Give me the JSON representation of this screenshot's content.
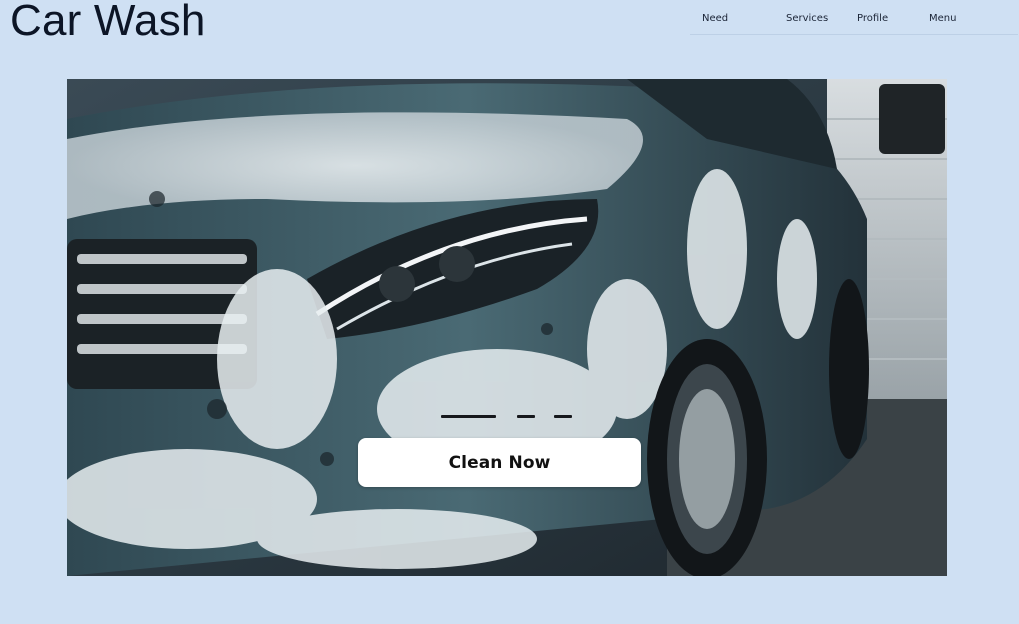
{
  "header": {
    "brand": "Car Wash",
    "nav": [
      {
        "label": "Need"
      },
      {
        "label": "Services"
      },
      {
        "label": "Profile"
      },
      {
        "label": "Menu"
      }
    ]
  },
  "hero": {
    "cta_label": "Clean Now",
    "slide_indicators": [
      {
        "active": true
      },
      {
        "active": false
      },
      {
        "active": false
      }
    ]
  },
  "colors": {
    "page_background": "#cfe0f3",
    "text_dark": "#0c1526",
    "button_background": "#ffffff"
  }
}
